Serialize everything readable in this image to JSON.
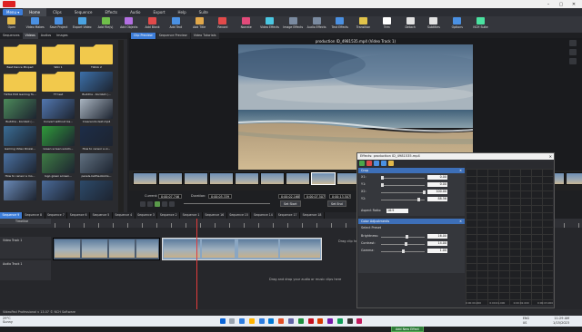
{
  "window": {
    "controls": [
      "–",
      "▢",
      "✕"
    ]
  },
  "menubar": {
    "menu_button": "Menu ▾",
    "tabs": [
      "Home",
      "Clips",
      "Sequence",
      "Effects",
      "Audio",
      "Export",
      "Help",
      "Suite"
    ],
    "active_tab": "Home"
  },
  "ribbon": {
    "buttons": [
      {
        "label": "Open",
        "color": "#e2b84a"
      },
      {
        "label": "Video Makes",
        "color": "#4a90e2"
      },
      {
        "label": "Save Project",
        "color": "#4a90e2"
      },
      {
        "label": "Export Video",
        "color": "#4aa3e2"
      },
      {
        "label": "Add File(s)",
        "color": "#6fbf4a"
      },
      {
        "label": "Add Objects",
        "color": "#b36fe2"
      },
      {
        "label": "Add Blank",
        "color": "#e24a4a"
      },
      {
        "label": "Add Text",
        "color": "#4a90e2"
      },
      {
        "label": "Add Title",
        "color": "#e2a84a"
      },
      {
        "label": "Record",
        "color": "#e24a4a"
      },
      {
        "label": "Narrate",
        "color": "#e24a7a"
      },
      {
        "label": "Video Effects",
        "color": "#4ac7e2"
      },
      {
        "label": "Image Effects",
        "color": "#7a8aa0"
      },
      {
        "label": "Audio Effects",
        "color": "#7a8aa0"
      },
      {
        "label": "Text Effects",
        "color": "#4a90e2"
      },
      {
        "label": "Transition",
        "color": "#e2c44a"
      },
      {
        "label": "Trim",
        "color": "#ffffff"
      },
      {
        "label": "Detach",
        "color": "#e2e2e2"
      },
      {
        "label": "Subtitles",
        "color": "#e2e2e2"
      },
      {
        "label": "Options",
        "color": "#4a90e2"
      },
      {
        "label": "NCH Suite",
        "color": "#4ae2a0"
      }
    ]
  },
  "bin": {
    "tabs": [
      "Sequences",
      "Videos",
      "Audios",
      "Images"
    ],
    "active_tab": "Videos",
    "items": [
      {
        "label": "Best Dance Mixped",
        "kind": "folder"
      },
      {
        "label": "Wiki 1",
        "kind": "folder"
      },
      {
        "label": "Tiktok 2",
        "kind": "folder"
      },
      {
        "label": "TikTok Edit Gaming Tu...",
        "kind": "folder"
      },
      {
        "label": "TT test",
        "kind": "folder"
      },
      {
        "label": "Buddha - Kornbot (...",
        "kind": "thumb",
        "color": "#3c6fa8"
      },
      {
        "label": "Buddha - Kornbot (...",
        "kind": "thumb",
        "color": "#4c8a5a"
      },
      {
        "label": "Convert without los...",
        "kind": "thumb",
        "color": "#5277b0"
      },
      {
        "label": "Crescendo-text.mp4",
        "kind": "thumb",
        "color": "#a9b4c0"
      },
      {
        "label": "Gaming Video Rinzal...",
        "kind": "thumb",
        "color": "#3a6c94"
      },
      {
        "label": "Green screen solutn...",
        "kind": "thumb",
        "color": "#2f9a3a"
      },
      {
        "label": "How to censor a vi...",
        "kind": "thumb",
        "color": "#1d2d48"
      },
      {
        "label": "How to censor a mo...",
        "kind": "thumb",
        "color": "#4a70a0"
      },
      {
        "label": "logo green screen...",
        "kind": "thumb",
        "color": "#3e7b44"
      },
      {
        "label": "pexels-keithe-bloms...",
        "kind": "thumb",
        "color": "#607080"
      },
      {
        "label": "",
        "kind": "thumb",
        "color": "#6a8ab8"
      },
      {
        "label": "",
        "kind": "thumb",
        "color": "#4a6a98"
      },
      {
        "label": "",
        "kind": "thumb",
        "color": "#2d4a6a"
      }
    ]
  },
  "preview": {
    "tabs": [
      "Clip Preview",
      "Sequence Preview",
      "Video Tutorials"
    ],
    "active_tab": "Clip Preview",
    "title": "production ID_4981535.mp4 (Video Track 1)",
    "current_label": "Current:",
    "current_time": "0:00:07.746",
    "duration_label": "Duration:",
    "duration_time": "0:00:05.339",
    "in_time": "0:00:02.168",
    "out_time": "0:00:07.507",
    "end_time": "0:00:13.507",
    "set_start": "Set Start",
    "set_end": "Set End"
  },
  "sequence_tabs": [
    "Sequence 9",
    "Sequence 8",
    "Sequence 7",
    "Sequence 6",
    "Sequence 5",
    "Sequence 4",
    "Sequence 3",
    "Sequence 2",
    "Sequence 1",
    "Sequence 16",
    "Sequence 15",
    "Sequence 14",
    "Sequence 17",
    "Sequence 18"
  ],
  "timeline": {
    "label": "Timeline",
    "video_track": "Video Track 1",
    "audio_track": "Audio Track 1",
    "video_drop_msg": "Drag clip here to add to sequence",
    "audio_drop_msg": "Drag and drop your audio or music clips here"
  },
  "effects_dialog": {
    "title": "Effects: production ID_4981535.mp4",
    "crop": {
      "header": "Crop",
      "rows": [
        {
          "label": "X1:",
          "value": "0.00",
          "pos": 0.0
        },
        {
          "label": "Y1:",
          "value": "0.00",
          "pos": 0.0
        },
        {
          "label": "X2:",
          "value": "100.00",
          "pos": 1.0
        },
        {
          "label": "Y2:",
          "value": "88.56",
          "pos": 0.88
        }
      ],
      "aspect_label": "Aspect Ratio:",
      "aspect_value": "16:9"
    },
    "color": {
      "header": "Color Adjustments",
      "preset_label": "Select Preset",
      "rows": [
        {
          "label": "Brightness:",
          "value": "16.00",
          "pos": 0.58
        },
        {
          "label": "Contrast:",
          "value": "14.00",
          "pos": 0.57
        },
        {
          "label": "Gamma:",
          "value": "1.00",
          "pos": 0.5
        }
      ]
    },
    "add_effect": "Add New Effect",
    "timeline_times": [
      "0:00:00.000",
      "0:00:01.000",
      "0:00:02.000",
      "0:00:03.000"
    ]
  },
  "status_bar": "VideoPad Professional v 13.07 © NCH Software",
  "taskbar": {
    "weather_temp": "29°C",
    "weather_desc": "Sunny",
    "lang": "ENG",
    "region": "US",
    "time": "11:29 AM",
    "date": "1/15/2023",
    "app_icons": [
      "#2e7de0",
      "#ffb300",
      "#2e7de0",
      "#0078d4",
      "#e34f26",
      "#6264a7",
      "#1e8e3e",
      "#c50f1f",
      "#d83b01",
      "#7719aa",
      "#0f9d58",
      "#333333",
      "#c2185b"
    ]
  }
}
